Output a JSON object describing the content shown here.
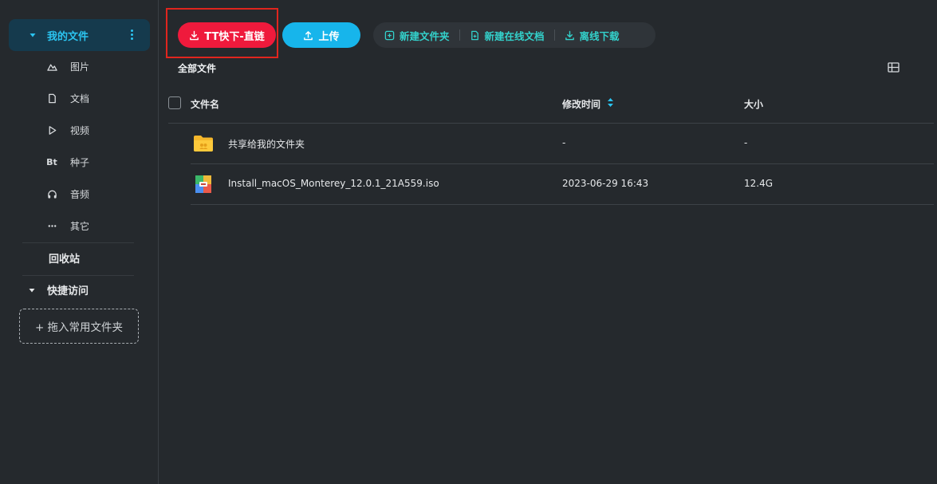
{
  "sidebar": {
    "root_label": "我的文件",
    "items": [
      {
        "label": "图片",
        "icon": "image-icon"
      },
      {
        "label": "文档",
        "icon": "document-icon"
      },
      {
        "label": "视频",
        "icon": "video-play-icon"
      },
      {
        "label": "种子",
        "icon": "torrent-icon",
        "icon_text": "Bt"
      },
      {
        "label": "音频",
        "icon": "headphones-icon"
      },
      {
        "label": "其它",
        "icon": "more-dots-icon"
      }
    ],
    "recycle_label": "回收站",
    "quick_access_label": "快捷访问",
    "drop_zone_label": "+ 拖入常用文件夹"
  },
  "toolbar": {
    "tt_label": "TT快下-直链",
    "upload_label": "上传",
    "new_folder_label": "新建文件夹",
    "new_online_doc_label": "新建在线文档",
    "offline_download_label": "离线下载"
  },
  "breadcrumb": "全部文件",
  "table": {
    "columns": [
      "文件名",
      "修改时间",
      "大小"
    ],
    "rows": [
      {
        "name": "共享给我的文件夹",
        "modified": "-",
        "size": "-",
        "type": "shared-folder"
      },
      {
        "name": "Install_macOS_Monterey_12.0.1_21A559.iso",
        "modified": "2023-06-29 16:43",
        "size": "12.4G",
        "type": "archive"
      }
    ]
  },
  "colors": {
    "accent": "#2bc4f0",
    "tt_button": "#ef1a3c",
    "upload_button": "#17b5eb",
    "action_text": "#33d1cb",
    "highlight_border": "#e0251e"
  }
}
